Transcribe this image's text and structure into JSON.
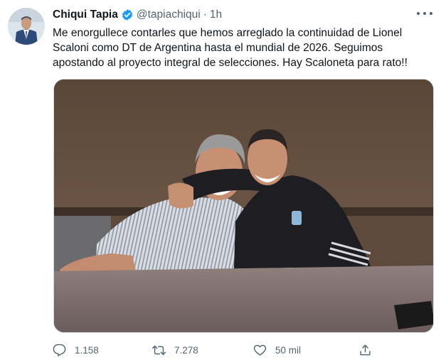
{
  "author": {
    "name": "Chiqui Tapia",
    "handle": "@tapiachiqui",
    "time": "1h",
    "separator": "·"
  },
  "tweet": {
    "lines": [
      "Me enorgullece contarles que hemos arreglado la continuidad de Lionel",
      "Scaloni como DT de Argentina hasta el mundial de 2026. Seguimos",
      "apostando al proyecto integral de selecciones. Hay Scaloneta para rato!!"
    ]
  },
  "actions": {
    "replies": "1.158",
    "retweets": "7.278",
    "likes": "50 mil"
  },
  "colors": {
    "verified": "#1d9bf0",
    "muted_text": "#536471",
    "text": "#0f1419"
  },
  "icons": [
    "verified-badge-icon",
    "more-icon",
    "reply-icon",
    "retweet-icon",
    "like-icon",
    "share-icon"
  ]
}
